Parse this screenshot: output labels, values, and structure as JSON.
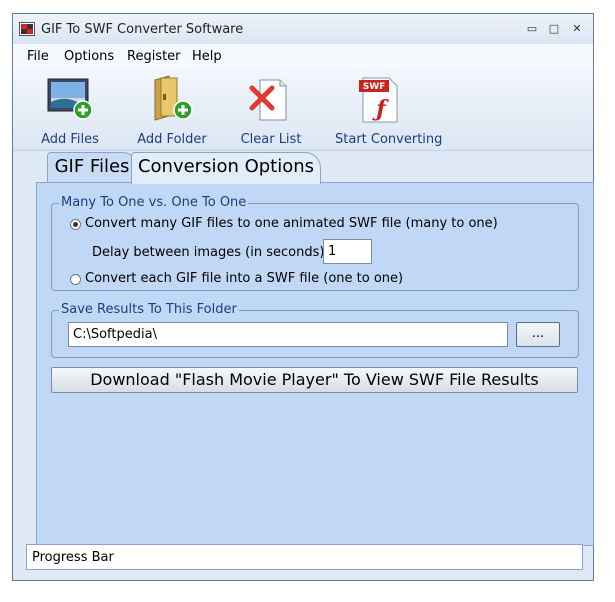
{
  "window": {
    "title": "GIF To SWF Converter Software",
    "minimize_glyph": "▭",
    "maximize_glyph": "□",
    "close_glyph": "✕"
  },
  "menu": {
    "file": "File",
    "options": "Options",
    "register": "Register",
    "help": "Help"
  },
  "toolbar": {
    "add_files": "Add Files",
    "add_folder": "Add Folder",
    "clear_list": "Clear List",
    "start_converting": "Start Converting",
    "swf_badge": "SWF"
  },
  "tabs": {
    "gif_files": "GIF Files",
    "conversion_options": "Conversion Options"
  },
  "mode_group": {
    "title": "Many To One vs. One To One",
    "option_many": "Convert many GIF files to one animated SWF file (many to one)",
    "delay_label": "Delay between images (in seconds):",
    "delay_value": "1",
    "option_one": "Convert each GIF file into a SWF file (one to one)",
    "selected": "many"
  },
  "save_group": {
    "title": "Save Results To This Folder",
    "folder": "C:\\Softpedia\\",
    "browse_label": "..."
  },
  "download_button": "Download \"Flash Movie Player\" To View SWF File Results",
  "progress": {
    "label": "Progress Bar"
  },
  "colors": {
    "panel": "#c0d7f6",
    "toolbar_text": "#1c3d82",
    "group_title": "#1a3e80",
    "add_badge": "#2e9e2e",
    "clear_x": "#e03a2e"
  }
}
